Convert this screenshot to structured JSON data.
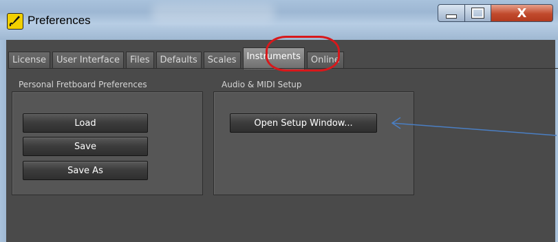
{
  "window": {
    "title": "Preferences",
    "controls": {
      "minimize_icon": "minimize-icon",
      "maximize_icon": "maximize-icon",
      "close_label": "X"
    }
  },
  "tabs": [
    {
      "label": "License",
      "active": false
    },
    {
      "label": "User Interface",
      "active": false
    },
    {
      "label": "Files",
      "active": false
    },
    {
      "label": "Defaults",
      "active": false
    },
    {
      "label": "Scales",
      "active": false
    },
    {
      "label": "Instruments",
      "active": true
    },
    {
      "label": "Online",
      "active": false
    }
  ],
  "groups": {
    "personal": {
      "title": "Personal Fretboard Preferences",
      "buttons": {
        "load": "Load",
        "save": "Save",
        "save_as": "Save As"
      }
    },
    "audio": {
      "title": "Audio & MIDI Setup",
      "buttons": {
        "open_setup": "Open Setup Window..."
      }
    }
  },
  "colors": {
    "annotation_circle": "#d8181b",
    "annotation_arrow": "#4a7fc4",
    "app_icon": "#f2d000"
  }
}
